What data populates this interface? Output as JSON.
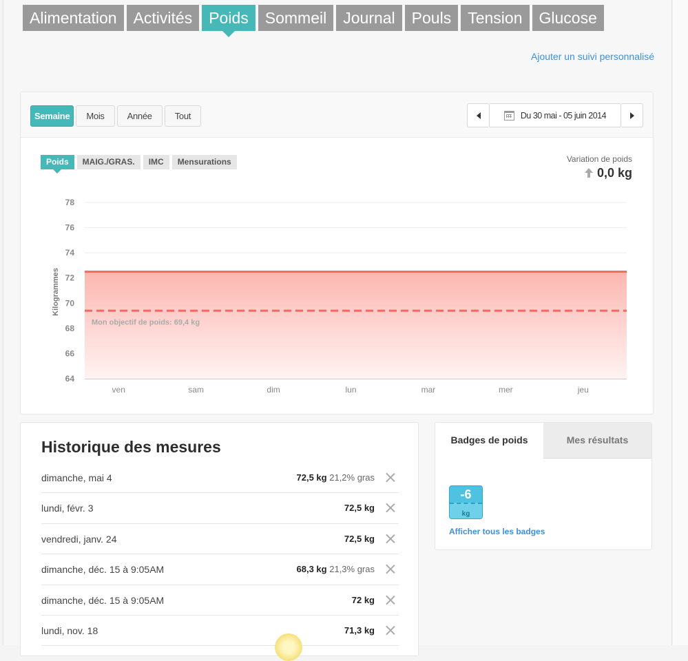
{
  "tabs": [
    "Alimentation",
    "Activités",
    "Poids",
    "Sommeil",
    "Journal",
    "Pouls",
    "Tension",
    "Glucose"
  ],
  "active_tab": "Poids",
  "custom_link": "Ajouter un suivi personnalisé",
  "range_buttons": [
    "Semaine",
    "Mois",
    "Année",
    "Tout"
  ],
  "active_range": "Semaine",
  "date_range": "Du 30 mai - 05 juin 2014",
  "metric_tabs": [
    "Poids",
    "MAIG./GRAS.",
    "IMC",
    "Mensurations"
  ],
  "active_metric": "Poids",
  "variation": {
    "label": "Variation de poids",
    "value": "0,0 kg"
  },
  "chart_data": {
    "type": "area",
    "ylabel": "Kilogrammes",
    "ylim": [
      64,
      78
    ],
    "yticks": [
      78,
      76,
      74,
      72,
      70,
      68,
      66,
      64
    ],
    "categories": [
      "ven",
      "sam",
      "dim",
      "lun",
      "mar",
      "mer",
      "jeu"
    ],
    "series": [
      {
        "values": [
          72.5,
          72.5,
          72.5,
          72.5,
          72.5,
          72.5,
          72.5
        ],
        "color": "#f36a5e"
      }
    ],
    "goal": {
      "value": 69.4,
      "label": "Mon objectif de poids: 69,4 kg",
      "color": "#f36a5e"
    },
    "grid": true
  },
  "history": {
    "title": "Historique des mesures",
    "rows": [
      {
        "date": "dimanche, mai 4",
        "weight": "72,5 kg",
        "fat": "21,2% gras"
      },
      {
        "date": "lundi, févr. 3",
        "weight": "72,5 kg",
        "fat": ""
      },
      {
        "date": "vendredi, janv. 24",
        "weight": "72,5 kg",
        "fat": ""
      },
      {
        "date": "dimanche, déc. 15 à 9:05AM",
        "weight": "68,3 kg",
        "fat": "21,3% gras"
      },
      {
        "date": "dimanche, déc. 15 à 9:05AM",
        "weight": "72 kg",
        "fat": ""
      },
      {
        "date": "lundi, nov. 18",
        "weight": "71,3 kg",
        "fat": ""
      }
    ]
  },
  "badges": {
    "tabs": [
      "Badges de poids",
      "Mes résultats"
    ],
    "active_tab": "Badges de poids",
    "badge_value": "-6",
    "badge_unit": "kg",
    "link": "Afficher tous les badges"
  },
  "colors": {
    "accent": "#45b8b7",
    "tab_inactive": "#9a9a9a",
    "link": "#3f8fd6",
    "chart_line": "#f36a5e"
  }
}
